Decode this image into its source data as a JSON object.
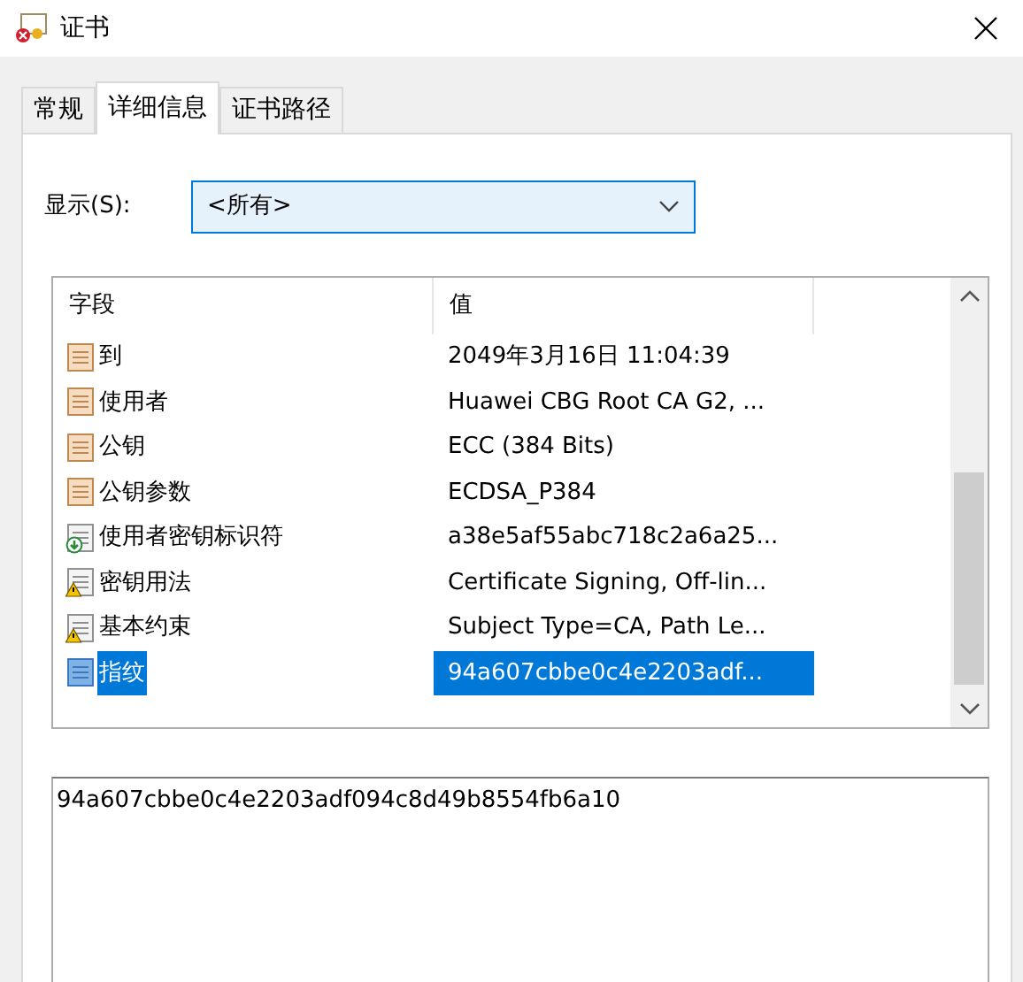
{
  "window": {
    "title": "证书"
  },
  "tabs": [
    {
      "label": "常规",
      "selected": false
    },
    {
      "label": "详细信息",
      "selected": true
    },
    {
      "label": "证书路径",
      "selected": false
    }
  ],
  "show": {
    "label": "显示(S):",
    "value": "<所有>"
  },
  "table": {
    "columns": [
      "字段",
      "值"
    ],
    "rows": [
      {
        "field": "到",
        "value": "2049年3月16日 11:04:39",
        "kind": "property",
        "selected": false
      },
      {
        "field": "使用者",
        "value": "Huawei CBG Root CA G2, ...",
        "kind": "property",
        "selected": false
      },
      {
        "field": "公钥",
        "value": "ECC (384 Bits)",
        "kind": "property",
        "selected": false
      },
      {
        "field": "公钥参数",
        "value": "ECDSA_P384",
        "kind": "property",
        "selected": false
      },
      {
        "field": "使用者密钥标识符",
        "value": "a38e5af55abc718c2a6a25...",
        "kind": "extension",
        "selected": false
      },
      {
        "field": "密钥用法",
        "value": "Certificate Signing, Off-lin...",
        "kind": "critical",
        "selected": false
      },
      {
        "field": "基本约束",
        "value": "Subject Type=CA, Path Le...",
        "kind": "critical",
        "selected": false
      },
      {
        "field": "指纹",
        "value": "94a607cbbe0c4e2203adf...",
        "kind": "property",
        "selected": true
      }
    ]
  },
  "detail": {
    "value": "94a607cbbe0c4e2203adf094c8d49b8554fb6a10"
  }
}
